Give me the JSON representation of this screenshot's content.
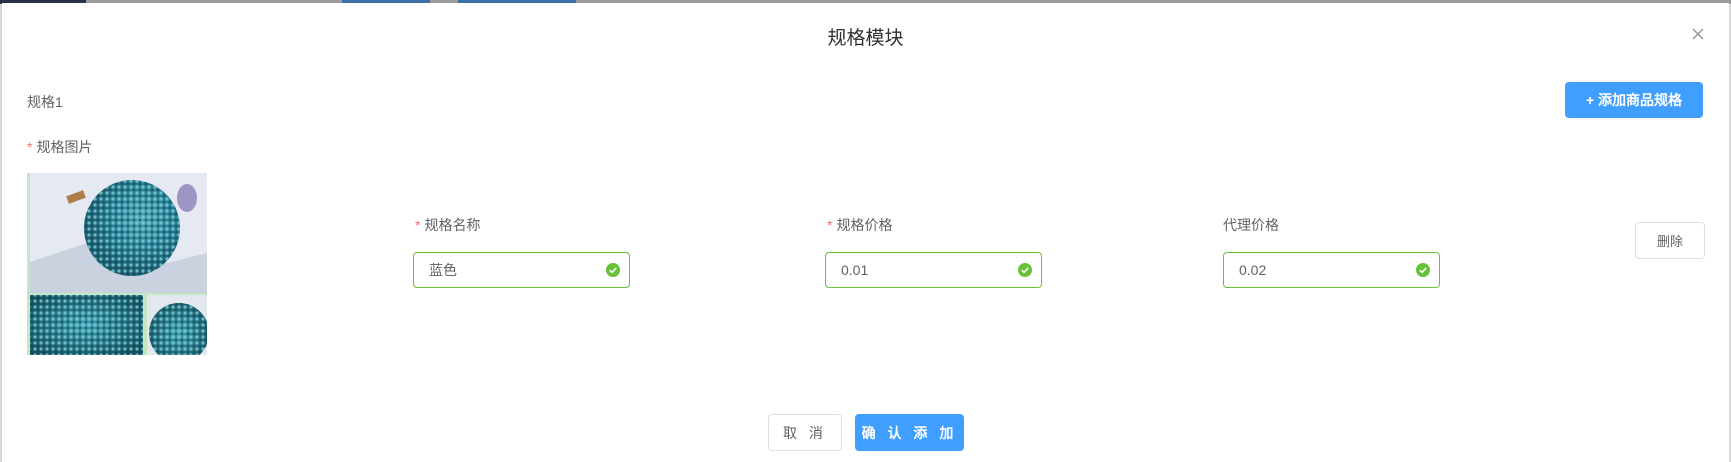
{
  "dialog": {
    "title": "规格模块",
    "close_icon": "close-icon"
  },
  "spec": {
    "group_label": "规格1",
    "add_button_label": "+ 添加商品规格",
    "image_label": "规格图片",
    "name": {
      "label": "规格名称",
      "value": "蓝色",
      "required": true
    },
    "price": {
      "label": "规格价格",
      "value": "0.01",
      "required": true
    },
    "agent_price": {
      "label": "代理价格",
      "value": "0.02",
      "required": false
    },
    "delete_label": "删除"
  },
  "footer": {
    "cancel_label": "取 消",
    "confirm_label": "确 认 添 加"
  },
  "colors": {
    "primary": "#409eff",
    "success": "#67c23a",
    "required": "#f56c6c"
  }
}
